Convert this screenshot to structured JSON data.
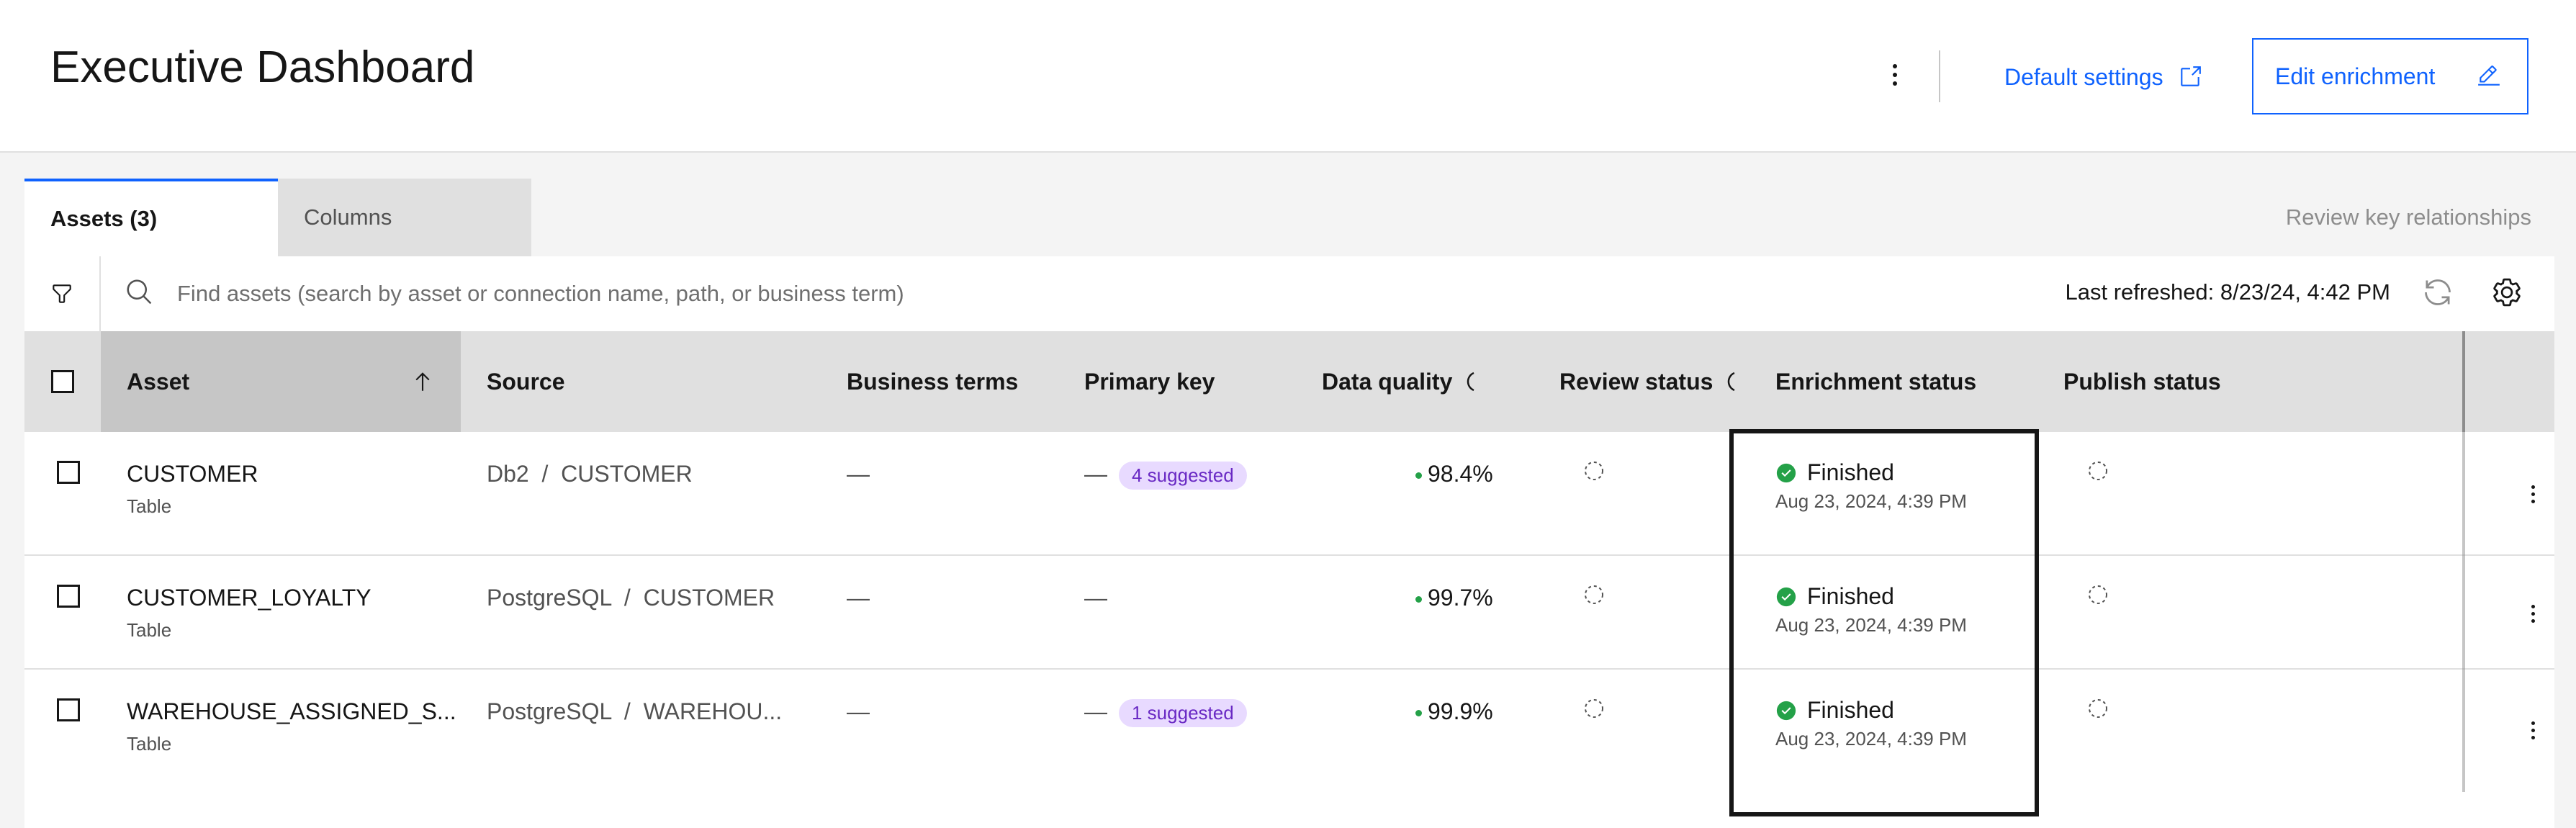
{
  "header": {
    "title": "Executive Dashboard",
    "default_settings": "Default settings",
    "edit_enrichment": "Edit enrichment"
  },
  "tabs": [
    {
      "label": "Assets (3)",
      "selected": true
    },
    {
      "label": "Columns",
      "selected": false
    }
  ],
  "review_key_relationships": "Review key relationships",
  "toolbar": {
    "search_placeholder": "Find assets (search by asset or connection name, path, or business term)",
    "last_refreshed": "Last refreshed: 8/23/24, 4:42 PM"
  },
  "table": {
    "columns": {
      "asset": "Asset",
      "source": "Source",
      "business_terms": "Business terms",
      "primary_key": "Primary key",
      "data_quality": "Data quality",
      "review_status": "Review status",
      "enrichment_status": "Enrichment status",
      "publish_status": "Publish status"
    },
    "sort": {
      "column": "asset",
      "direction": "ascending"
    },
    "rows": [
      {
        "name": "CUSTOMER",
        "type": "Table",
        "source": "Db2  /  CUSTOMER",
        "business_terms": "—",
        "primary_key": "—",
        "primary_key_tag": "4 suggested",
        "data_quality": "98.4%",
        "enrichment_status": "Finished",
        "enrichment_time": "Aug 23, 2024, 4:39 PM"
      },
      {
        "name": "CUSTOMER_LOYALTY",
        "type": "Table",
        "source": "PostgreSQL  /  CUSTOMER",
        "business_terms": "—",
        "primary_key": "—",
        "primary_key_tag": "",
        "data_quality": "99.7%",
        "enrichment_status": "Finished",
        "enrichment_time": "Aug 23, 2024, 4:39 PM"
      },
      {
        "name": "WAREHOUSE_ASSIGNED_S...",
        "type": "Table",
        "source": "PostgreSQL  /  WAREHOU...",
        "business_terms": "—",
        "primary_key": "—",
        "primary_key_tag": "1 suggested",
        "data_quality": "99.9%",
        "enrichment_status": "Finished",
        "enrichment_time": "Aug 23, 2024, 4:39 PM"
      }
    ]
  },
  "colors": {
    "accent": "#0f62fe",
    "success": "#24a148",
    "tag_bg": "#e8daff",
    "tag_text": "#6929c4"
  },
  "icons": {
    "launch": "launch-icon",
    "edit": "edit-icon",
    "filter": "filter-icon",
    "search": "search-icon",
    "refresh": "refresh-icon",
    "settings": "settings-icon",
    "sort": "arrow-up-icon",
    "pending": "pending-dashed-circle-icon",
    "finished": "checkmark-filled-icon",
    "overflow": "overflow-menu-vertical-icon"
  }
}
